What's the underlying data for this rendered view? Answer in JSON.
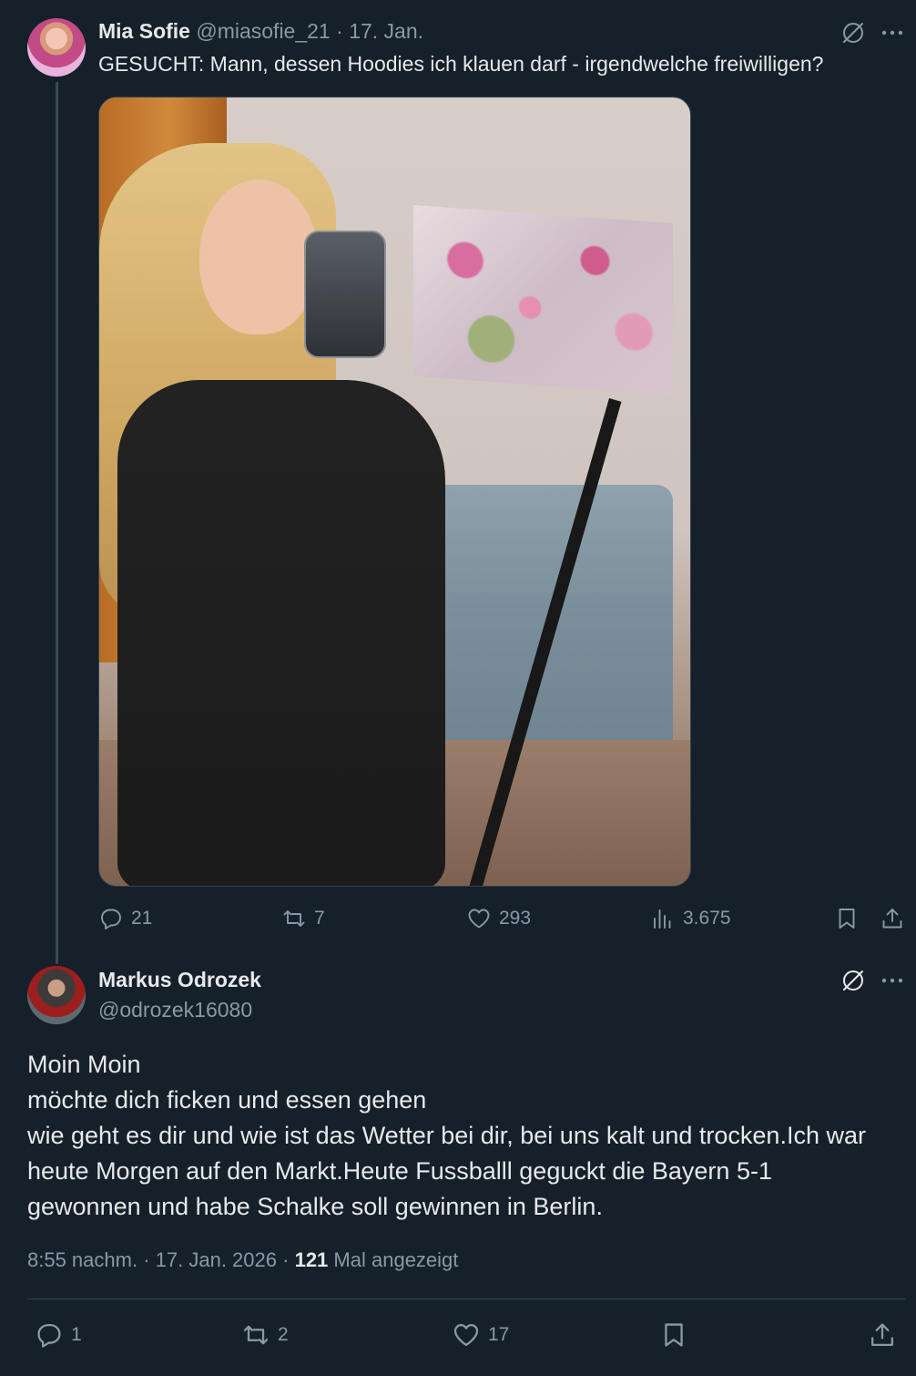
{
  "original_post": {
    "author_name": "Mia Sofie",
    "handle": "@miasofie_21",
    "separator": "·",
    "date": "17. Jan.",
    "text": "GESUCHT: Mann, dessen Hoodies ich klauen darf - irgendwelche freiwilligen?",
    "stats": {
      "replies": "21",
      "reposts": "7",
      "likes": "293",
      "views": "3.675"
    }
  },
  "reply": {
    "author_name": "Markus Odrozek",
    "handle": "@odrozek16080",
    "lines": [
      "Moin Moin",
      "möchte dich ficken und essen gehen",
      "wie geht es dir und wie ist das Wetter bei dir, bei uns kalt und trocken.Ich war",
      "heute Morgen auf den Markt.Heute Fussballl geguckt die Bayern 5-1",
      "gewonnen und habe Schalke soll gewinnen in Berlin."
    ],
    "time": "8:55 nachm.",
    "separator": "·",
    "full_date": "17. Jan. 2026",
    "views_count": "121",
    "views_label": "Mal angezeigt",
    "stats": {
      "replies": "1",
      "reposts": "2",
      "likes": "17"
    }
  },
  "icons": {
    "grok": "grok-icon",
    "more": "more-icon",
    "reply": "reply-icon",
    "repost": "repost-icon",
    "like": "heart-icon",
    "views": "analytics-icon",
    "bookmark": "bookmark-icon",
    "share": "share-icon"
  },
  "colors": {
    "background": "#15202b",
    "text": "#e7e9ea",
    "muted": "#8b98a5",
    "border": "#38444d"
  }
}
